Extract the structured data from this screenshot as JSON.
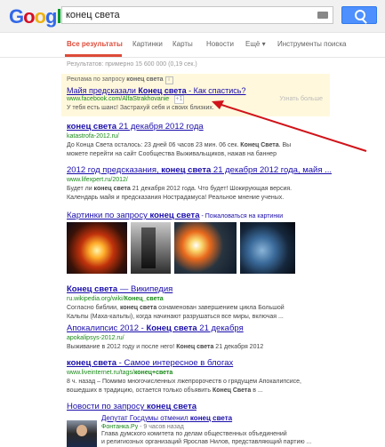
{
  "header": {
    "logo_letters": [
      "G",
      "o",
      "o",
      "g",
      "l",
      "e"
    ],
    "logo_colors": [
      "#3369e8",
      "#d50f25",
      "#eeb211",
      "#3369e8",
      "#009925",
      "#d50f25"
    ],
    "search_query": "конец света"
  },
  "tabs": {
    "all": "Все результаты",
    "images": "Картинки",
    "maps": "Карты",
    "news": "Новости",
    "more": "Ещё ▾",
    "tools": "Инструменты поиска"
  },
  "stats": "Результатов: примерно 15 600 000 (0,19 сек.)",
  "ad": {
    "label_prefix": "Реклама по запросу ",
    "label_query": "конец света",
    "info_icon": "i",
    "title_prefix": "Майя предсказали ",
    "title_bold": "Конец света",
    "title_suffix": " - Как спастись?",
    "url": "www.facebook.com/AlfaStrakhovanie",
    "plus": "+1",
    "desc": "У тебя есть шанс! Застрахуй себя и своих близких.",
    "right_text": "Узнать больше"
  },
  "results": [
    {
      "title_bold": "конец света",
      "title_rest": " 21 декабря 2012 года",
      "url": "katastrofa-2012.ru/",
      "snippet": [
        "До Конца Света осталось: 23 дней 06 часов 23 мин. 06 сек. ",
        "Конец Света",
        ". Вы",
        "можете перейти на сайт Сообщества Выживальщиков, нажав на баннер"
      ]
    },
    {
      "title_pre": "2012 год предсказания, ",
      "title_bold": "конец света",
      "title_rest": " 21 декабря 2012 года, майя ...",
      "url": "www.lifexpert.ru/2012/",
      "snippet": [
        "Будет ли ",
        "конец света",
        " 21 декабря 2012 года. Что будет! Шокирующая версия.",
        "Календарь майя и предсказания Нострадамуса! Реальное мнение ученых."
      ]
    }
  ],
  "images_header": {
    "prefix": "Картинки по запросу ",
    "query": "конец света",
    "report": " - Пожаловаться на картинки"
  },
  "results2": [
    {
      "title_bold": "Конец света",
      "title_rest": " — Википедия",
      "url_pre": "ru.wikipedia.org/wiki/",
      "url_bold": "Конец_света",
      "line1_pre": "Согласно библии, ",
      "line1_bold": "конец света",
      "line1_rest": " ознаменован завершением цикла Большой",
      "line2": "Кальпы (Маха-кальпы), когда начинают разрушаться все миры, включая ..."
    },
    {
      "title_pre": "Апокалипсис 2012 - ",
      "title_bold": "Конец света",
      "title_rest": " 21 декабря",
      "url": "apokalipsys-2012.ru/",
      "line1_pre": "Выживание в 2012 году и после него! ",
      "line1_bold": "Конец света",
      "line1_rest": " 21 декабря 2012"
    },
    {
      "title_bold": "конец света",
      "title_rest": " - Самое интересное в блогах",
      "url_pre": "www.liveinternet.ru/tags/",
      "url_bold": "конец+света",
      "line1": "8 ч. назад – Помимо многочисленных лжепророчеств о грядущем Апокалипсисе,",
      "line2_pre": "вошедших в традицию, остается только объявить ",
      "line2_bold": "Конец Света",
      "line2_rest": " в ..."
    }
  ],
  "news": {
    "header_pre": "Новости по запросу ",
    "header_bold": "конец света",
    "item_pre": "Депутат Госдумы отменил ",
    "item_bold": "конец света",
    "source": "Фонтанка.Ру",
    "time": " - 9 часов назад",
    "snip1_pre": "Глава думского комитета по ",
    "snip1_rest": "делам общественных объединений",
    "snip2": "и религиозных организаций Ярослав Нилов, представляющий партию ..."
  }
}
